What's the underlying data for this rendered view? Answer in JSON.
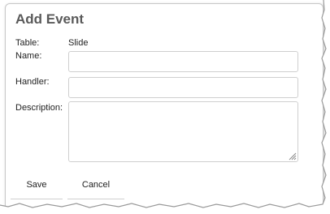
{
  "dialog": {
    "title": "Add Event",
    "table_label": "Table:",
    "table_value": "Slide",
    "name_label": "Name:",
    "name_value": "",
    "handler_label": "Handler:",
    "handler_value": "",
    "description_label": "Description:",
    "description_value": "",
    "save_label": "Save",
    "cancel_label": "Cancel"
  },
  "icons": {
    "resize": "resize-grip-icon"
  }
}
